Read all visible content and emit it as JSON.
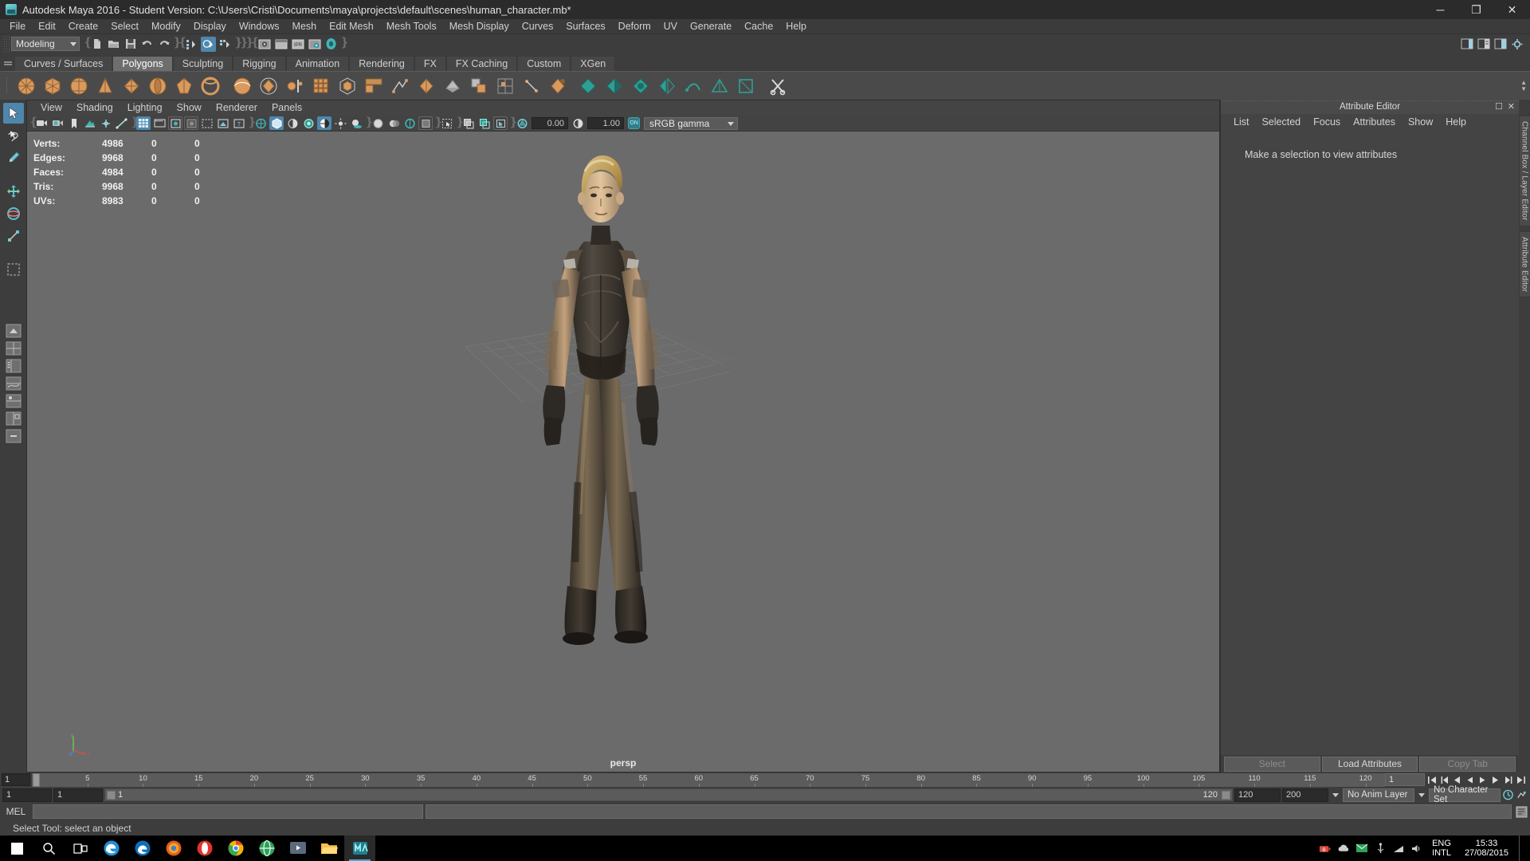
{
  "window": {
    "title": "Autodesk Maya 2016 - Student Version: C:\\Users\\Cristi\\Documents\\maya\\projects\\default\\scenes\\human_character.mb*",
    "app_icon": "maya-icon",
    "minimize": "─",
    "maximize": "❐",
    "close": "✕"
  },
  "menubar": {
    "items": [
      {
        "label": "File"
      },
      {
        "label": "Edit"
      },
      {
        "label": "Create"
      },
      {
        "label": "Select"
      },
      {
        "label": "Modify"
      },
      {
        "label": "Display"
      },
      {
        "label": "Windows"
      },
      {
        "label": "Mesh"
      },
      {
        "label": "Edit Mesh"
      },
      {
        "label": "Mesh Tools"
      },
      {
        "label": "Mesh Display"
      },
      {
        "label": "Curves"
      },
      {
        "label": "Surfaces"
      },
      {
        "label": "Deform"
      },
      {
        "label": "UV"
      },
      {
        "label": "Generate"
      },
      {
        "label": "Cache"
      },
      {
        "label": "Help"
      }
    ]
  },
  "statusline": {
    "mode": "Modeling",
    "icons": [
      "new-scene-icon",
      "open-scene-icon",
      "save-scene-icon",
      "undo-icon",
      "redo-icon",
      "select-by-hierarchy-icon",
      "select-by-object-icon",
      "select-by-component-icon",
      "render-current-frame-icon",
      "render-view-icon",
      "ipr-render-icon",
      "render-settings-icon",
      "hypershade-icon"
    ],
    "ipr_label": "IPR",
    "right_icons": [
      "sidebar-toggle-icon",
      "attribute-editor-toggle-icon",
      "channel-box-toggle-icon",
      "settings-icon"
    ]
  },
  "shelf": {
    "tabs": [
      {
        "label": "Curves / Surfaces",
        "active": false
      },
      {
        "label": "Polygons",
        "active": true
      },
      {
        "label": "Sculpting",
        "active": false
      },
      {
        "label": "Rigging",
        "active": false
      },
      {
        "label": "Animation",
        "active": false
      },
      {
        "label": "Rendering",
        "active": false
      },
      {
        "label": "FX",
        "active": false
      },
      {
        "label": "FX Caching",
        "active": false
      },
      {
        "label": "Custom",
        "active": false
      },
      {
        "label": "XGen",
        "active": false
      }
    ],
    "buttons": [
      "poly-sphere-icon",
      "poly-cube-icon",
      "poly-cylinder-icon",
      "poly-cone-icon",
      "poly-pyramid-icon",
      "poly-torus-icon",
      "poly-prism-icon",
      "poly-pipe-icon",
      "poly-helix-icon",
      "poly-platonic-icon",
      "poly-soccer-ball-icon",
      "poly-super-ellipse-icon",
      "poly-plane-icon",
      "poly-disc-icon",
      "poly-gear-icon",
      "poly-create-tool-icon",
      "poly-sculpt-icon",
      "poly-extrude-icon",
      "poly-bevel-icon",
      "poly-bridge-icon",
      "poly-combine-icon",
      "poly-separate-icon",
      "poly-smooth-icon",
      "poly-booleans-union-icon",
      "poly-booleans-difference-icon",
      "poly-booleans-intersection-icon",
      "poly-mirror-icon",
      "poly-reduce-icon",
      "poly-triangulate-icon",
      "poly-quadrangulate-icon",
      "poly-cut-face-icon"
    ]
  },
  "toolbox": {
    "tools": [
      {
        "name": "select-tool",
        "selected": true
      },
      {
        "name": "lasso-tool",
        "selected": false
      },
      {
        "name": "paint-select-tool",
        "selected": false
      },
      {
        "name": "move-tool",
        "selected": false
      },
      {
        "name": "rotate-tool",
        "selected": false
      },
      {
        "name": "scale-tool",
        "selected": false
      },
      {
        "name": "last-tool-used",
        "selected": false
      }
    ],
    "layouts": [
      "single-perspective-view-icon",
      "four-view-icon",
      "persp-outliner-icon",
      "persp-graph-editor-icon",
      "hypershade-persp-icon",
      "persp-uv-editor-icon",
      "minimize-layout-icon"
    ]
  },
  "viewport": {
    "menus": [
      {
        "label": "View"
      },
      {
        "label": "Shading"
      },
      {
        "label": "Lighting"
      },
      {
        "label": "Show"
      },
      {
        "label": "Renderer"
      },
      {
        "label": "Panels"
      }
    ],
    "toolbar_icons": [
      "select-camera-icon",
      "camera-attributes-icon",
      "bookmark-icon",
      "image-plane-icon",
      "two-d-pan-zoom-icon",
      "oriented-bbox-icon",
      "grid-toggle-icon",
      "film-gate-icon",
      "resolution-gate-icon",
      "gate-mask-icon",
      "field-chart-icon",
      "safe-action-icon",
      "safe-title-icon",
      "wireframe-icon",
      "smooth-shade-all-icon",
      "shade-flat-icon",
      "use-default-material-icon",
      "shaded-textured-icon",
      "use-all-lights-icon",
      "shadows-icon",
      "screen-space-ao-icon",
      "motion-blur-icon",
      "multisample-aa-icon",
      "depth-of-field-icon",
      "isolate-select-icon",
      "xray-icon",
      "xray-joints-icon",
      "xray-active-components-icon",
      "exposure-icon",
      "gamma-icon"
    ],
    "exposure_value": "0.00",
    "gamma_value": "1.00",
    "color_toggle": "ON",
    "color_profile": "sRGB gamma",
    "hud": {
      "rows": [
        {
          "label": "Verts:",
          "total": "4986",
          "selected": "0",
          "extra": "0"
        },
        {
          "label": "Edges:",
          "total": "9968",
          "selected": "0",
          "extra": "0"
        },
        {
          "label": "Faces:",
          "total": "4984",
          "selected": "0",
          "extra": "0"
        },
        {
          "label": "Tris:",
          "total": "9968",
          "selected": "0",
          "extra": "0"
        },
        {
          "label": "UVs:",
          "total": "8983",
          "selected": "0",
          "extra": "0"
        }
      ]
    },
    "camera_label": "persp",
    "axis": {
      "x": "x",
      "y": "y",
      "z": "z"
    }
  },
  "attribute_editor": {
    "title": "Attribute Editor",
    "menus": [
      {
        "label": "List"
      },
      {
        "label": "Selected"
      },
      {
        "label": "Focus"
      },
      {
        "label": "Attributes"
      },
      {
        "label": "Show"
      },
      {
        "label": "Help"
      }
    ],
    "empty_message": "Make a selection to view attributes",
    "buttons": [
      {
        "label": "Select",
        "enabled": false
      },
      {
        "label": "Load Attributes",
        "enabled": true
      },
      {
        "label": "Copy Tab",
        "enabled": false
      }
    ]
  },
  "side_tabs": [
    {
      "label": "Channel Box / Layer Editor"
    },
    {
      "label": "Attribute Editor"
    }
  ],
  "timeline": {
    "current_frame": "1",
    "ticks": [
      "5",
      "10",
      "15",
      "20",
      "25",
      "30",
      "35",
      "40",
      "45",
      "50",
      "55",
      "60",
      "65",
      "70",
      "75",
      "80",
      "85",
      "90",
      "95",
      "100",
      "105",
      "110",
      "115",
      "120"
    ],
    "frame_field": "1",
    "playback_buttons": [
      "go-to-start-icon",
      "step-back-frame-icon",
      "step-back-key-icon",
      "play-backwards-icon",
      "play-forwards-icon",
      "step-forward-key-icon",
      "step-forward-frame-icon",
      "go-to-end-icon"
    ]
  },
  "rangebar": {
    "start_field": "1",
    "anim_start_field": "1",
    "range_left_label": "1",
    "range_right_label": "120",
    "anim_end_field": "120",
    "end_field": "200",
    "anim_layer": "No Anim Layer",
    "character_set": "No Character Set",
    "icons": [
      "auto-key-icon",
      "animation-preferences-icon"
    ]
  },
  "command_line": {
    "label": "MEL",
    "input_value": "",
    "output_value": "",
    "script_editor_icon": "script-editor-icon"
  },
  "help_line": {
    "text": "Select Tool: select an object"
  },
  "taskbar": {
    "start": "start-button",
    "search": "search-icon",
    "taskview": "task-view-icon",
    "apps": [
      {
        "name": "edge-icon",
        "active": false
      },
      {
        "name": "edge-legacy-icon",
        "active": false
      },
      {
        "name": "firefox-icon",
        "active": false
      },
      {
        "name": "opera-icon",
        "active": false
      },
      {
        "name": "chrome-icon",
        "active": false
      },
      {
        "name": "globe-browser-icon",
        "active": false
      },
      {
        "name": "media-player-icon",
        "active": false
      },
      {
        "name": "file-explorer-icon",
        "active": false
      },
      {
        "name": "maya-taskbar-icon",
        "active": true
      }
    ],
    "tray": [
      "battery-icon",
      "onedrive-icon",
      "mail-icon",
      "usb-icon",
      "network-icon",
      "volume-icon"
    ],
    "language_top": "ENG",
    "language_bottom": "INTL",
    "time": "15:33",
    "date": "27/08/2015"
  },
  "colors": {
    "accent": "#4e87ad",
    "shelf_orange": "#d99a5e",
    "teal": "#3fb5b5",
    "viewport_bg": "#6b6b6b"
  }
}
